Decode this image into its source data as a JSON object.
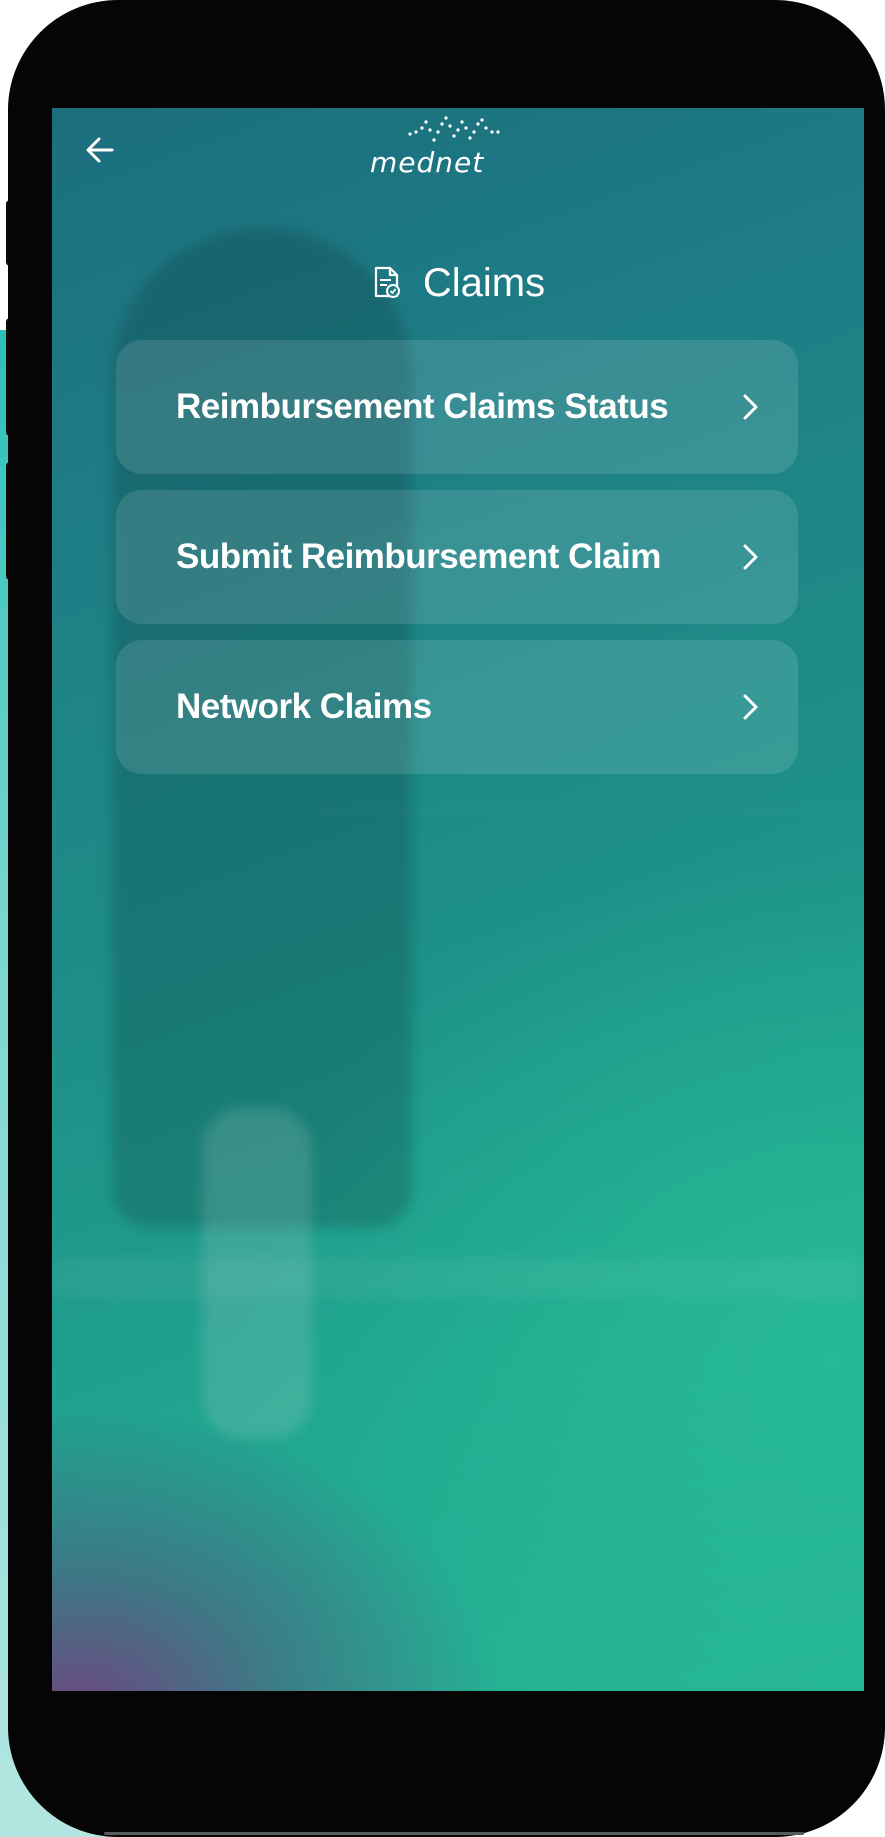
{
  "app": {
    "brand": "mednet"
  },
  "header": {
    "back_icon": "arrow-left-icon",
    "title_icon": "document-icon",
    "title": "Claims"
  },
  "menu": {
    "items": [
      {
        "label": "Reimbursement Claims Status",
        "icon": "chevron-right-icon"
      },
      {
        "label": "Submit Reimbursement Claim",
        "icon": "chevron-right-icon"
      },
      {
        "label": "Network Claims",
        "icon": "chevron-right-icon"
      }
    ]
  },
  "colors": {
    "accent": "#1fa596",
    "gradient_top": "#1c6e7e",
    "gradient_bottom_left": "#7a377d",
    "text": "#ffffff"
  }
}
